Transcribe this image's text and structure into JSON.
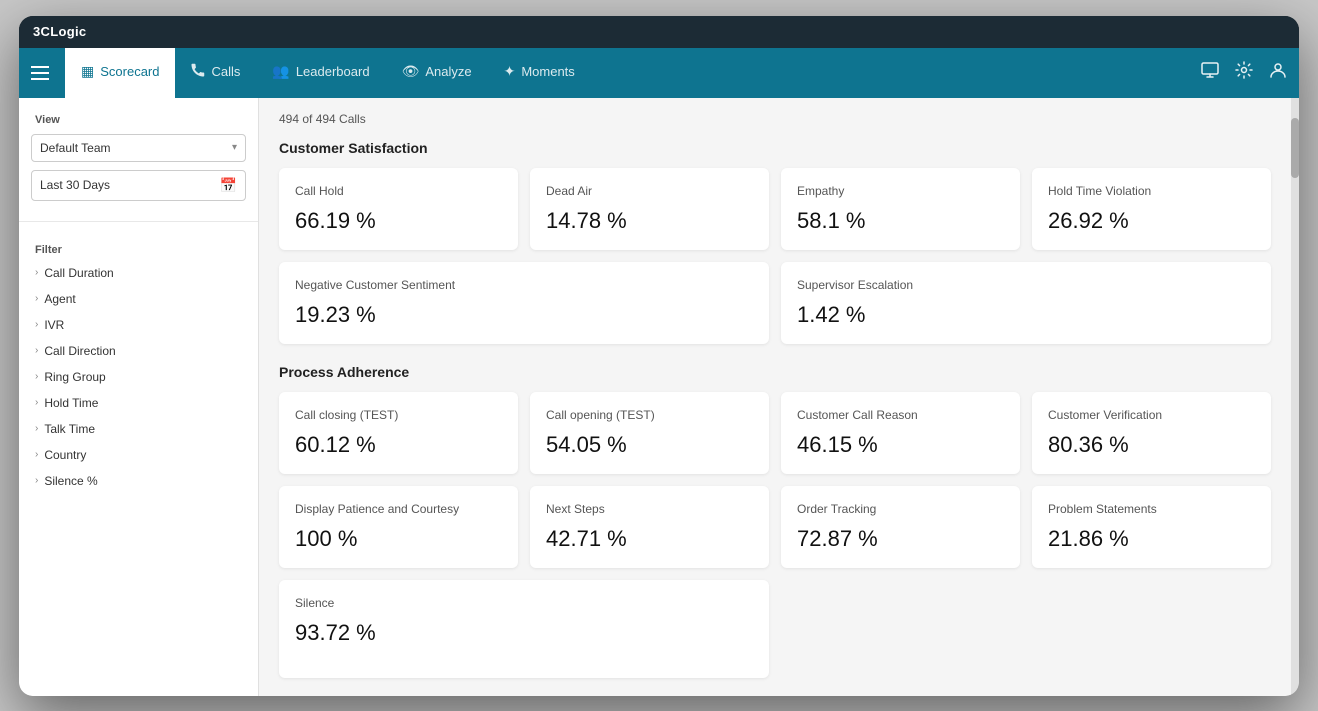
{
  "app": {
    "title": "3CLogic"
  },
  "nav": {
    "tabs": [
      {
        "id": "scorecard",
        "label": "Scorecard",
        "icon": "▦",
        "active": true
      },
      {
        "id": "calls",
        "label": "Calls",
        "icon": "📞",
        "active": false
      },
      {
        "id": "leaderboard",
        "label": "Leaderboard",
        "icon": "👥",
        "active": false
      },
      {
        "id": "analyze",
        "label": "Analyze",
        "icon": "👁",
        "active": false
      },
      {
        "id": "moments",
        "label": "Moments",
        "icon": "✦",
        "active": false
      }
    ],
    "right_icons": [
      "monitor",
      "gear",
      "user"
    ]
  },
  "sidebar": {
    "view_label": "View",
    "team_select": "Default Team",
    "date_select": "Last 30 Days",
    "filter_label": "Filter",
    "filter_items": [
      "Call Duration",
      "Agent",
      "IVR",
      "Call Direction",
      "Ring Group",
      "Hold Time",
      "Talk Time",
      "Country",
      "Silence %"
    ]
  },
  "main": {
    "calls_count": "494 of 494 Calls",
    "customer_satisfaction": {
      "section_title": "Customer Satisfaction",
      "cards_row1": [
        {
          "label": "Call Hold",
          "value": "66.19 %"
        },
        {
          "label": "Dead Air",
          "value": "14.78 %"
        },
        {
          "label": "Empathy",
          "value": "58.1 %"
        },
        {
          "label": "Hold Time Violation",
          "value": "26.92 %"
        }
      ],
      "cards_row2": [
        {
          "label": "Negative Customer Sentiment",
          "value": "19.23 %"
        },
        {
          "label": "Supervisor Escalation",
          "value": "1.42 %"
        }
      ]
    },
    "process_adherence": {
      "section_title": "Process Adherence",
      "cards_row1": [
        {
          "label": "Call closing (TEST)",
          "value": "60.12 %"
        },
        {
          "label": "Call opening (TEST)",
          "value": "54.05 %"
        },
        {
          "label": "Customer Call Reason",
          "value": "46.15 %"
        },
        {
          "label": "Customer Verification",
          "value": "80.36 %"
        }
      ],
      "cards_row2": [
        {
          "label": "Display Patience and Courtesy",
          "value": "100 %"
        },
        {
          "label": "Next Steps",
          "value": "42.71 %"
        },
        {
          "label": "Order Tracking",
          "value": "72.87 %"
        },
        {
          "label": "Problem Statements",
          "value": "21.86 %"
        }
      ]
    },
    "silence": {
      "section_title": "Silence",
      "partial_value": "93.72 %"
    }
  }
}
